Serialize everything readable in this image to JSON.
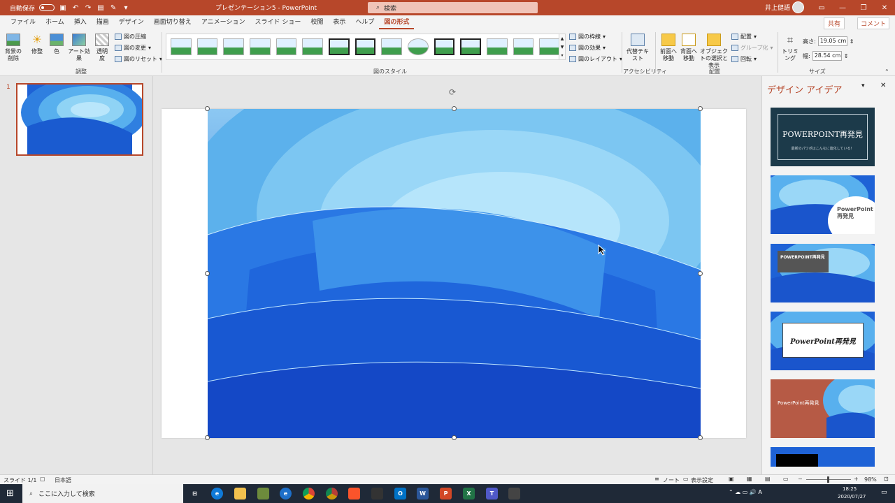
{
  "titlebar": {
    "autosave": "自動保存",
    "autosave_state": "オフ",
    "doc_title": "プレゼンテーション5 - PowerPoint",
    "search": "検索",
    "user": "井上健語"
  },
  "tabs": [
    "ファイル",
    "ホーム",
    "挿入",
    "描画",
    "デザイン",
    "画面切り替え",
    "アニメーション",
    "スライド ショー",
    "校閲",
    "表示",
    "ヘルプ",
    "図の形式"
  ],
  "share": "共有",
  "comment": "コメント",
  "ribbon": {
    "remove_bg": "背景の削除",
    "corrections": "修整",
    "color": "色",
    "artistic": "アート効果",
    "transparency": "透明度",
    "compress": "図の圧縮",
    "change": "図の変更",
    "reset": "図のリセット",
    "group_adjust": "調整",
    "group_styles": "図のスタイル",
    "border": "図の枠線",
    "effects": "図の効果",
    "layout": "図のレイアウト",
    "alt_text": "代替テキスト",
    "group_access": "アクセシビリティ",
    "forward": "前面へ移動",
    "backward": "背面へ移動",
    "selection": "オブジェクトの選択と表示",
    "align": "配置",
    "group": "グループ化",
    "rotate": "回転",
    "group_arrange": "配置",
    "crop": "トリミング",
    "height_label": "高さ:",
    "height": "19.05 cm",
    "width_label": "幅:",
    "width": "28.54 cm",
    "group_size": "サイズ"
  },
  "thumbs": {
    "slide_no": "1"
  },
  "design_pane": {
    "title": "デザイン アイデア",
    "ideas": [
      {
        "title": "POWERPOINT再発見",
        "sub": "最新のパワポはこんなに進化している！"
      },
      {
        "title": "PowerPoint 再発見"
      },
      {
        "title": "POWERPOINT再発見"
      },
      {
        "title": "PowerPoint再発見"
      },
      {
        "title": "PowerPoint再発見"
      }
    ]
  },
  "status": {
    "slide": "スライド 1/1",
    "lang": "日本語",
    "notes": "ノート",
    "display": "表示設定",
    "zoom": "98%"
  },
  "taskbar": {
    "search": "ここに入力して検索",
    "time": "18:25",
    "date": "2020/07/27"
  }
}
